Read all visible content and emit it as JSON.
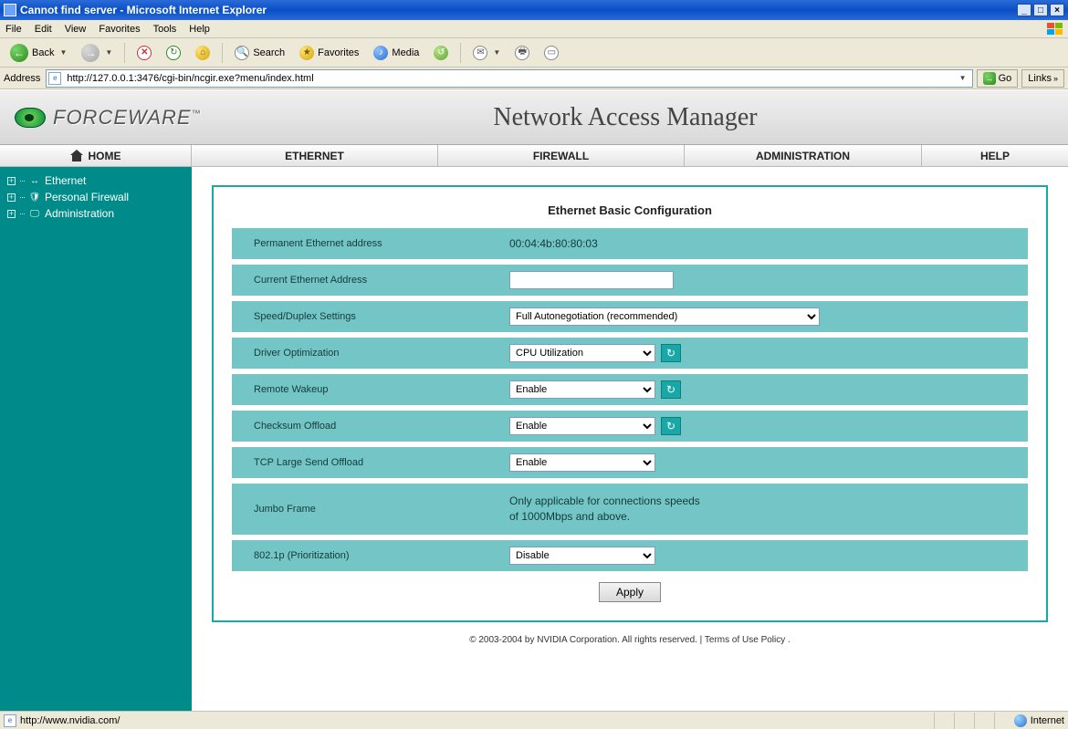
{
  "window": {
    "title": "Cannot find server - Microsoft Internet Explorer"
  },
  "menus": {
    "file": "File",
    "edit": "Edit",
    "view": "View",
    "favorites": "Favorites",
    "tools": "Tools",
    "help": "Help"
  },
  "toolbar": {
    "back": "Back",
    "search": "Search",
    "favorites": "Favorites",
    "media": "Media"
  },
  "addressbar": {
    "label": "Address",
    "value": "http://127.0.0.1:3476/cgi-bin/ncgir.exe?menu/index.html",
    "go": "Go",
    "links": "Links"
  },
  "header": {
    "brand": "FORCEWARE",
    "tm": "™",
    "title": "Network Access Manager"
  },
  "topnav": {
    "home": "HOME",
    "ethernet": "ETHERNET",
    "firewall": "FIREWALL",
    "administration": "ADMINISTRATION",
    "help": "HELP"
  },
  "sidebar": {
    "ethernet": "Ethernet",
    "personal_firewall": "Personal Firewall",
    "administration": "Administration"
  },
  "panel": {
    "title": "Ethernet Basic Configuration",
    "rows": {
      "perm_addr_label": "Permanent Ethernet address",
      "perm_addr_value": "00:04:4b:80:80:03",
      "curr_addr_label": "Current Ethernet Address",
      "curr_addr_value": "",
      "speed_label": "Speed/Duplex Settings",
      "speed_value": "Full Autonegotiation (recommended)",
      "driver_opt_label": "Driver Optimization",
      "driver_opt_value": "CPU Utilization",
      "remote_wakeup_label": "Remote Wakeup",
      "remote_wakeup_value": "Enable",
      "checksum_label": "Checksum Offload",
      "checksum_value": "Enable",
      "tcp_lso_label": "TCP Large Send Offload",
      "tcp_lso_value": "Enable",
      "jumbo_label": "Jumbo Frame",
      "jumbo_note": "Only applicable for connections speeds of 1000Mbps and above.",
      "p8021_label": "802.1p (Prioritization)",
      "p8021_value": "Disable"
    },
    "apply": "Apply"
  },
  "footer": {
    "copyright": "© 2003-2004 by NVIDIA Corporation. All rights reserved. | ",
    "terms": "Terms of Use Policy",
    "period": " ."
  },
  "statusbar": {
    "url": "http://www.nvidia.com/",
    "zone": "Internet"
  }
}
